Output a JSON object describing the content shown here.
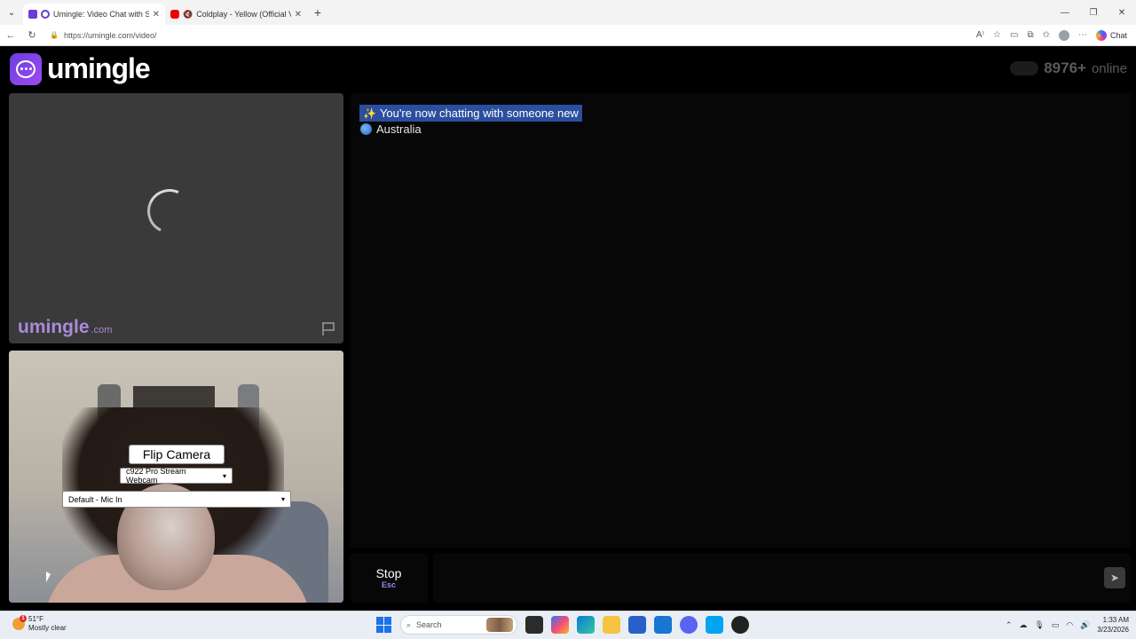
{
  "browser": {
    "tabs": [
      {
        "title": "Umingle: Video Chat with Stra",
        "active": true
      },
      {
        "title": "Coldplay - Yellow (Official Vid",
        "active": false
      }
    ],
    "url": "https://umingle.com/video/",
    "copilot_label": "Chat"
  },
  "site": {
    "brand": "umingle",
    "online_count": "8976+",
    "online_label": "online",
    "watermark": "umingle",
    "watermark_domain": ".com"
  },
  "self_video": {
    "flip_label": "Flip Camera",
    "camera_selected": "c922 Pro Stream Webcam",
    "mic_selected": "Default - Mic In"
  },
  "chat": {
    "status_message": "You're now chatting with someone new",
    "location": "Australia"
  },
  "controls": {
    "stop_label": "Stop",
    "stop_key": "Esc"
  },
  "taskbar": {
    "temperature": "51°F",
    "weather": "Mostly clear",
    "search_placeholder": "Search",
    "time": "1:33 AM",
    "date": "3/23/2026"
  },
  "colors": {
    "brand_purple": "#6c3bd9",
    "highlight": "#2b4f9e"
  }
}
